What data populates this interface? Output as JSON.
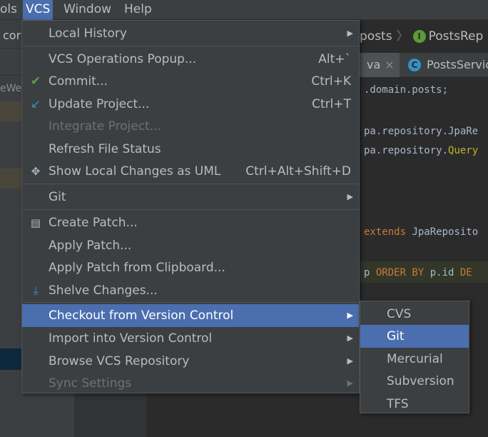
{
  "menubar": {
    "items": [
      {
        "label": "ols"
      },
      {
        "label": "VCS"
      },
      {
        "label": "Window"
      },
      {
        "label": "Help"
      }
    ]
  },
  "project_panel": {
    "truncated_label": "cor",
    "tree_fragment": "eWe"
  },
  "breadcrumb": {
    "items": [
      "posts",
      "PostsRep"
    ]
  },
  "editor_tabs": [
    {
      "label": "va",
      "close": "×"
    },
    {
      "label": "PostsServic"
    }
  ],
  "code_lines": [
    {
      "text": ".domain.posts;"
    },
    {
      "text": "pa.repository.JpaRe"
    },
    {
      "pre": "pa.repository.",
      "typed": "Query"
    },
    {
      "kw": "extends",
      "rest": " JpaReposito"
    },
    {
      "pre": "p ",
      "kw2": "ORDER BY",
      "mid": " p.id ",
      "kw3": "DE"
    }
  ],
  "vcs_menu": {
    "items": [
      {
        "label": "Local History",
        "submenu": true
      },
      {
        "label": "VCS Operations Popup...",
        "shortcut": "Alt+`"
      },
      {
        "label": "Commit...",
        "shortcut": "Ctrl+K",
        "icon": "check-icon"
      },
      {
        "label": "Update Project...",
        "shortcut": "Ctrl+T",
        "icon": "update-arrow-icon"
      },
      {
        "label": "Integrate Project...",
        "disabled": true
      },
      {
        "label": "Refresh File Status"
      },
      {
        "label": "Show Local Changes as UML",
        "shortcut": "Ctrl+Alt+Shift+D",
        "icon": "uml-diagram-icon"
      },
      {
        "label": "Git",
        "submenu": true
      },
      {
        "label": "Create Patch...",
        "icon": "patch-icon"
      },
      {
        "label": "Apply Patch..."
      },
      {
        "label": "Apply Patch from Clipboard..."
      },
      {
        "label": "Shelve Changes...",
        "icon": "shelve-icon"
      },
      {
        "label": "Checkout from Version Control",
        "submenu": true,
        "selected": true
      },
      {
        "label": "Import into Version Control",
        "submenu": true
      },
      {
        "label": "Browse VCS Repository",
        "submenu": true
      },
      {
        "label": "Sync Settings",
        "submenu": true,
        "disabled": true
      }
    ]
  },
  "checkout_submenu": {
    "items": [
      {
        "label": "CVS"
      },
      {
        "label": "Git",
        "selected": true
      },
      {
        "label": "Mercurial"
      },
      {
        "label": "Subversion"
      },
      {
        "label": "TFS"
      }
    ]
  },
  "colors": {
    "menu_bg": "#3c3f41",
    "selection": "#4b6eaf",
    "text": "#bbbbbb",
    "disabled_text": "#707070",
    "editor_bg": "#2b2b2b",
    "keyword": "#cc7832"
  }
}
